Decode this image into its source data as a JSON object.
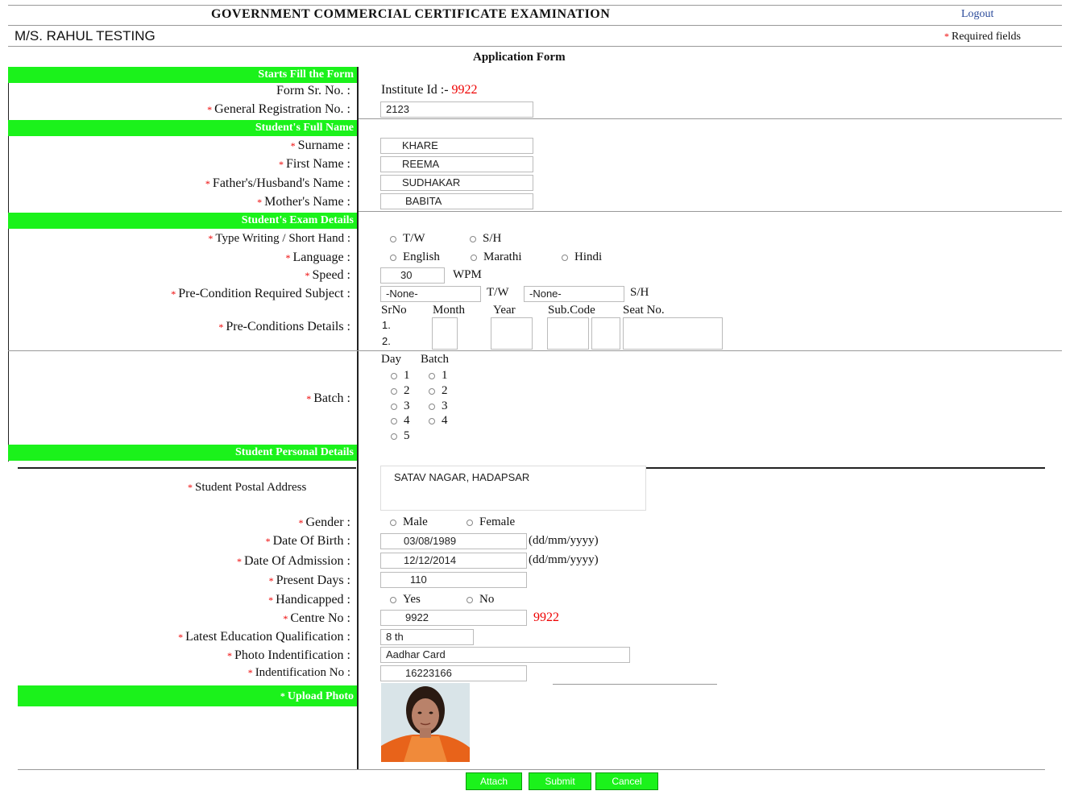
{
  "header": {
    "title": "GOVERNMENT COMMERCIAL CERTIFICATE EXAMINATION",
    "logout": "Logout",
    "institute_name": "M/S. RAHUL TESTING",
    "required_star": "*",
    "required_text": "Required fields"
  },
  "form_title": "Application Form",
  "sections": {
    "start": "Starts Fill the Form",
    "full_name": "Student's Full Name",
    "exam": "Student's Exam Details",
    "personal": "Student Personal Details",
    "upload": "Upload Photo"
  },
  "labels": {
    "form_sr": "Form Sr. No. :",
    "gen_reg": "General Registration No. :",
    "surname": "Surname :",
    "first_name": "First Name :",
    "father": "Father's/Husband's Name :",
    "mother": "Mother's Name :",
    "type": "Type Writing / Short Hand :",
    "language": "Language :",
    "speed": "Speed :",
    "precond_subject": "Pre-Condition Required Subject :",
    "precond_details": "Pre-Conditions Details :",
    "batch": "Batch :",
    "postal": "Student Postal Address",
    "gender": "Gender :",
    "dob": "Date Of Birth :",
    "doa": "Date Of Admission :",
    "present_days": "Present Days :",
    "handicapped": "Handicapped :",
    "centre": "Centre No :",
    "education": "Latest Education Qualification :",
    "photo_id": "Photo Indentification :",
    "id_no": "Indentification No :"
  },
  "values": {
    "institute_prefix": "Institute Id :-",
    "institute_id": "9922",
    "gen_reg": "2123",
    "surname": "KHARE",
    "first_name": "REEMA",
    "father": "SUDHAKAR",
    "mother": "BABITA",
    "speed": "30",
    "speed_unit": "WPM",
    "precond_tw": "-None-",
    "precond_tw_label": "T/W",
    "precond_sh": "-None-",
    "precond_sh_label": "S/H",
    "address": "SATAV NAGAR, HADAPSAR",
    "dob": "03/08/1989",
    "dob_fmt": "(dd/mm/yyyy)",
    "doa": "12/12/2014",
    "doa_fmt": "(dd/mm/yyyy)",
    "present_days": "110",
    "centre": "9922",
    "centre_display": "9922",
    "education": "8 th",
    "photo_id": "Aadhar Card",
    "id_no": "16223166"
  },
  "options": {
    "type": [
      "T/W",
      "S/H"
    ],
    "language": [
      "English",
      "Marathi",
      "Hindi"
    ],
    "gender": [
      "Male",
      "Female"
    ],
    "handicapped": [
      "Yes",
      "No"
    ]
  },
  "precond_headers": [
    "SrNo",
    "Month",
    "Year",
    "Sub.Code",
    "Seat No."
  ],
  "precond_rows": [
    "1.",
    "2."
  ],
  "batch": {
    "day_header": "Day",
    "batch_header": "Batch",
    "days": [
      "1",
      "2",
      "3",
      "4",
      "5"
    ],
    "batches": [
      "1",
      "2",
      "3",
      "4"
    ]
  },
  "buttons": {
    "attach": "Attach",
    "submit": "Submit",
    "cancel": "Cancel"
  },
  "colors": {
    "section_green": "#1bf21b",
    "required_red": "#e00000"
  }
}
